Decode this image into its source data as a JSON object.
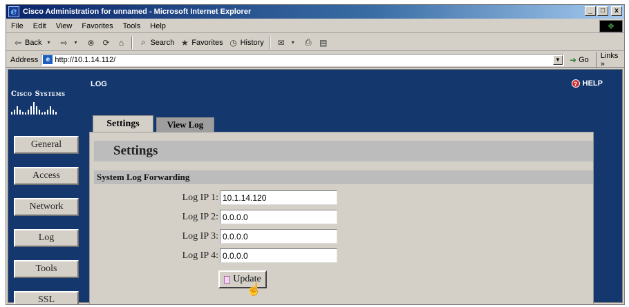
{
  "window": {
    "title": "Cisco Administration for unnamed - Microsoft Internet Explorer",
    "controls": {
      "minimize": "_",
      "maximize": "□",
      "close": "x"
    }
  },
  "menubar": {
    "items": [
      "File",
      "Edit",
      "View",
      "Favorites",
      "Tools",
      "Help"
    ]
  },
  "toolbar": {
    "back_label": "Back",
    "search_label": "Search",
    "favorites_label": "Favorites",
    "history_label": "History"
  },
  "addressbar": {
    "label": "Address",
    "url": "http://10.1.14.112/",
    "go_label": "Go",
    "links_label": "Links »"
  },
  "app": {
    "logo_text": "Cisco Systems",
    "page_label": "LOG",
    "help_label": "HELP",
    "nav": [
      "General",
      "Access",
      "Network",
      "Log",
      "Tools",
      "SSL"
    ],
    "tabs": [
      "Settings",
      "View Log"
    ],
    "heading": "Settings",
    "section_title": "System Log Forwarding",
    "fields": [
      {
        "label": "Log IP 1:",
        "value": "10.1.14.120"
      },
      {
        "label": "Log IP 2:",
        "value": "0.0.0.0"
      },
      {
        "label": "Log IP 3:",
        "value": "0.0.0.0"
      },
      {
        "label": "Log IP 4:",
        "value": "0.0.0.0"
      }
    ],
    "update_label": "Update"
  },
  "colors": {
    "page_background": "#14386e",
    "panel": "#d4d0c8",
    "section_bar": "#bcbcbc",
    "titlebar": "#0a246a"
  }
}
